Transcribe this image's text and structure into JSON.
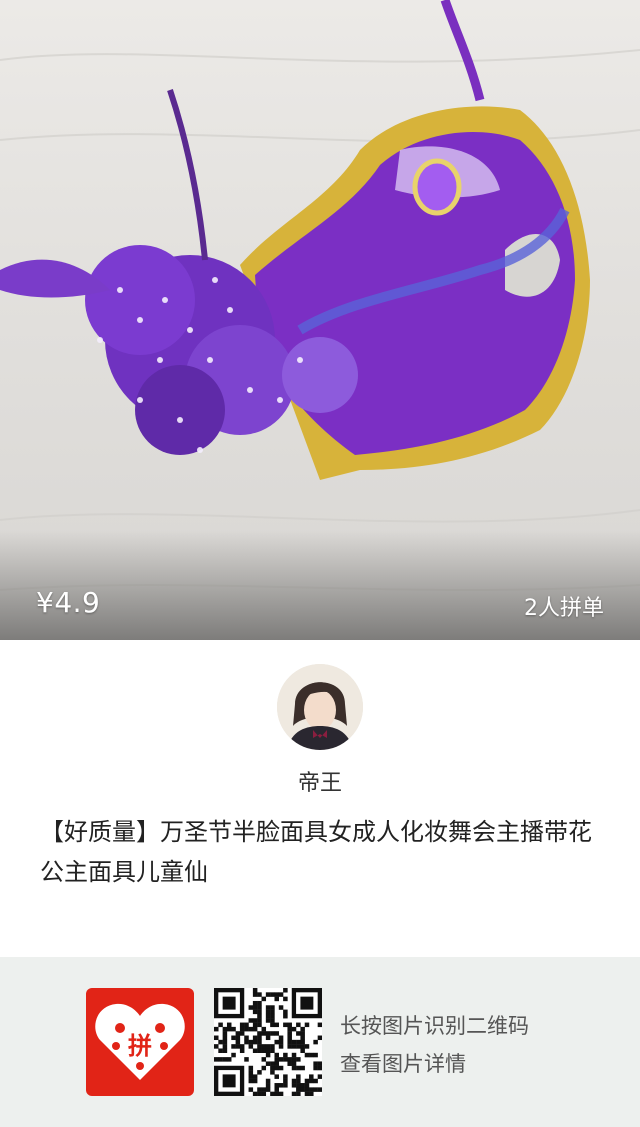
{
  "product": {
    "price": "¥4.9",
    "group_buy": "2人拼单",
    "title": "【好质量】万圣节半脸面具女成人化妆舞会主播带花公主面具儿童仙"
  },
  "seller": {
    "name": "帝王"
  },
  "footer": {
    "hint_line1": "长按图片识别二维码",
    "hint_line2": "查看图片详情",
    "logo_text": "拼"
  },
  "colors": {
    "brand_red": "#e12417",
    "mask_purple": "#7b2fc4",
    "gold": "#d7b33a",
    "footer_bg": "#edf0ee"
  }
}
